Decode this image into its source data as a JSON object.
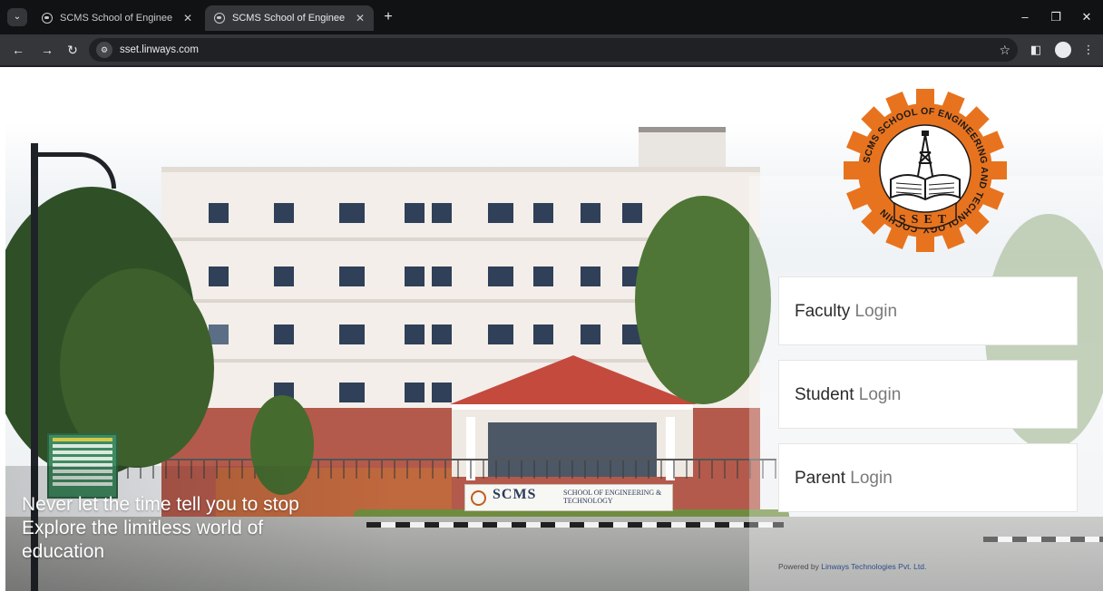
{
  "browser": {
    "tabs": [
      {
        "title": "SCMS School of Engineering &",
        "active": false
      },
      {
        "title": "SCMS School of Engineering &",
        "active": true
      }
    ],
    "new_tab_symbol": "+",
    "close_symbol": "✕",
    "url": "sset.linways.com",
    "icons": {
      "back": "back-arrow-icon",
      "forward": "forward-arrow-icon",
      "reload": "reload-icon",
      "site_info": "tune-icon",
      "bookmark": "star-icon",
      "side_panel": "side-panel-icon",
      "profile": "profile-icon",
      "menu": "kebab-menu-icon"
    }
  },
  "page": {
    "logo": {
      "ring_text": "SCMS SCHOOL OF ENGINEERING AND TECHNOLOGY, COCHIN",
      "initials": "SSET",
      "colors": {
        "gear": "#e8731e",
        "ring": "#ffffff",
        "ink": "#1a1a1a"
      }
    },
    "login_buttons": [
      {
        "strong": "Faculty",
        "light": "Login"
      },
      {
        "strong": "Student",
        "light": "Login"
      },
      {
        "strong": "Parent",
        "light": "Login"
      }
    ],
    "tagline": {
      "line1": "Never let the time tell you to stop",
      "line2": "Explore the limitless world of",
      "line3": "education"
    },
    "footer": {
      "prefix": "Powered by",
      "company": "Linways Technologies Pvt. Ltd."
    },
    "campus_board": {
      "main": "SCMS",
      "sub": "SCHOOL OF ENGINEERING & TECHNOLOGY"
    }
  }
}
